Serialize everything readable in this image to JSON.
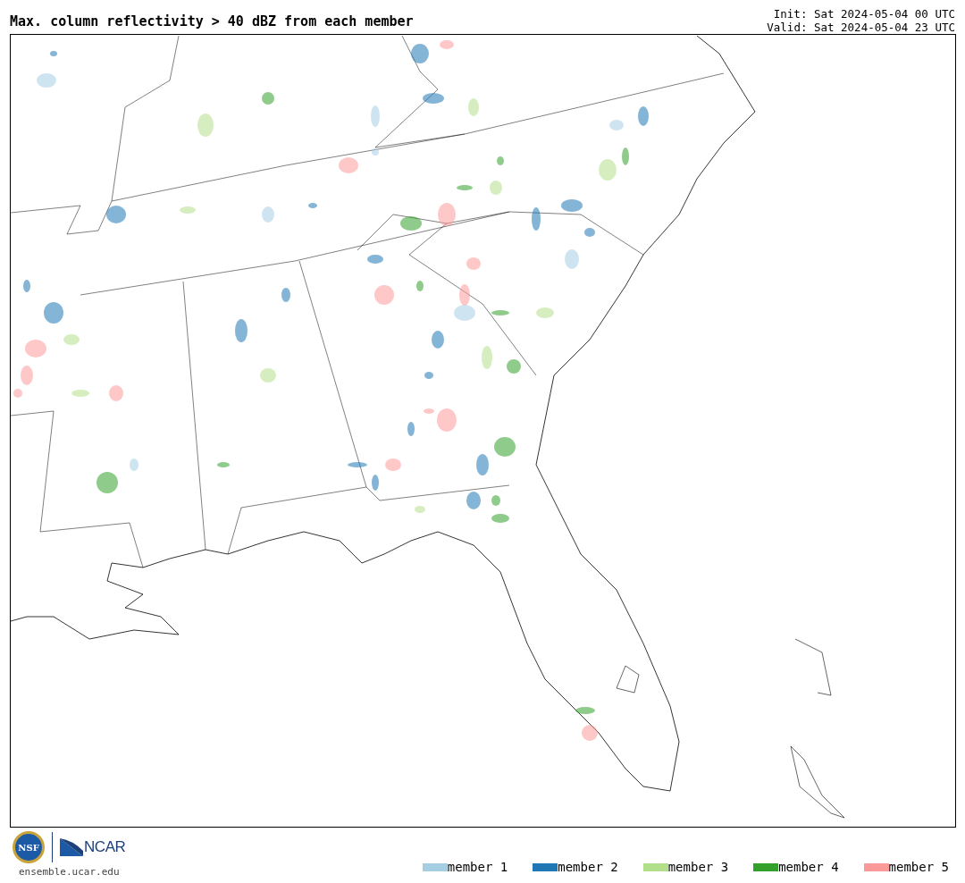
{
  "title": "Max. column reflectivity > 40 dBZ from each member",
  "init": "Init: Sat 2024-05-04 00 UTC",
  "valid": "Valid: Sat 2024-05-04 23 UTC",
  "logos": {
    "nsf": "NSF",
    "ncar": "NCAR"
  },
  "site": "ensemble.ucar.edu",
  "legend": [
    {
      "label": "member 1",
      "color": "#a6cee3"
    },
    {
      "label": "member 2",
      "color": "#1f78b4"
    },
    {
      "label": "member 3",
      "color": "#b2df8a"
    },
    {
      "label": "member 4",
      "color": "#33a02c"
    },
    {
      "label": "member 5",
      "color": "#fb9a99"
    }
  ]
}
